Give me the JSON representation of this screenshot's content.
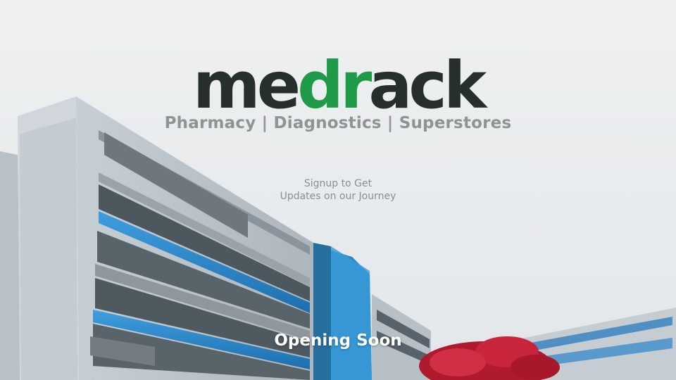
{
  "brand": {
    "logo_part1": "me",
    "logo_part2": "dr",
    "logo_part3": "ack",
    "tagline": "Pharmacy | Diagnostics | Superstores",
    "accent_color": "#1f9a48",
    "logo_color": "#262f2b"
  },
  "signup": {
    "line1": "Signup to Get",
    "line2": "Updates on our Journey"
  },
  "status": {
    "text": "Opening Soon"
  },
  "background": {
    "image": "office-building-under-sky-with-red-tree"
  }
}
